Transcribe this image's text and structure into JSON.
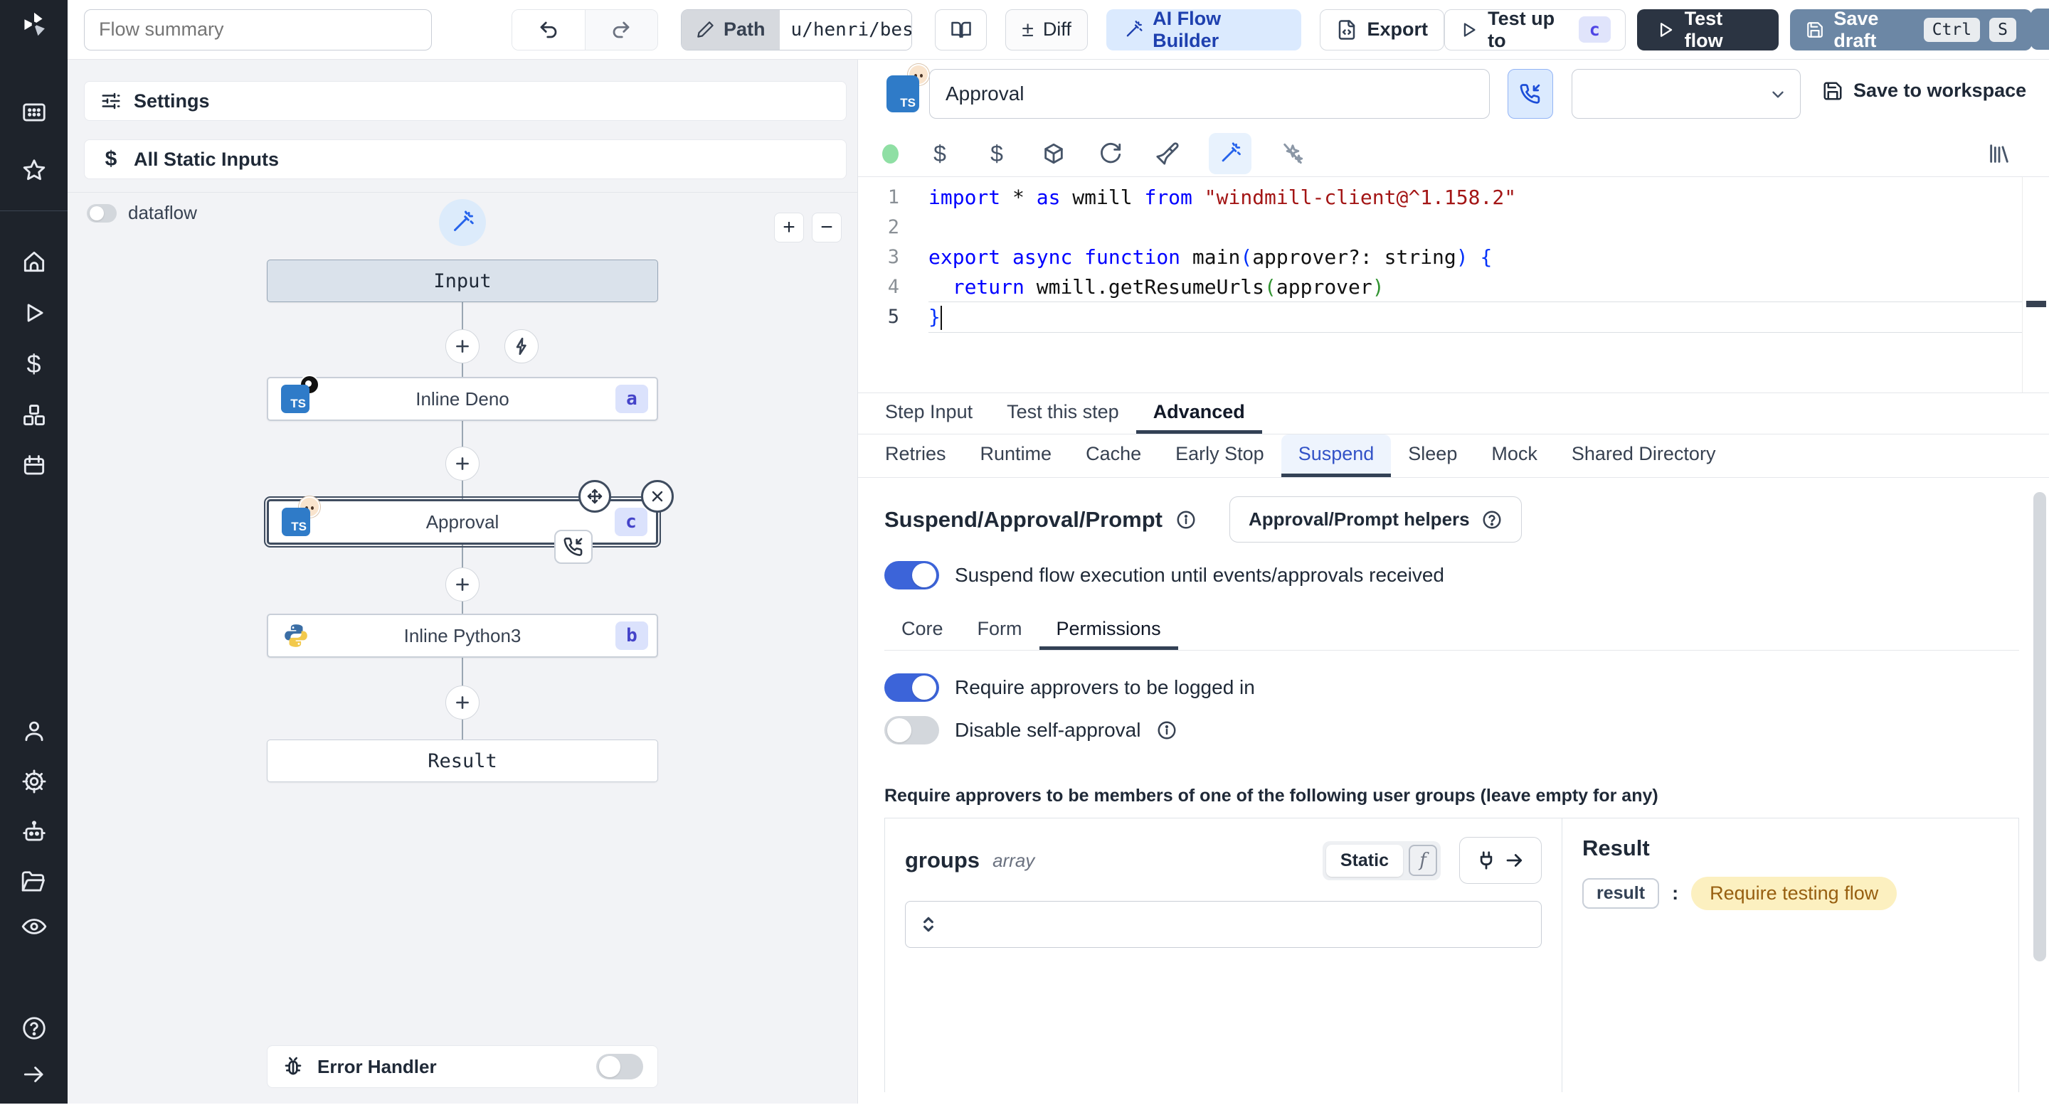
{
  "colors": {
    "rail_bg": "#1e232b",
    "accent_blue": "#3c64d9",
    "ai_button_bg": "#dbeafe",
    "test_flow_bg": "#2b3442",
    "save_draft_bg": "#6c87a5",
    "result_pill_bg": "#fcf0c0",
    "result_pill_text": "#975f10",
    "node_selected_border": "#3f4c5f",
    "suspend_tab_text": "#3353c7"
  },
  "sidebar": {
    "icons": [
      "windmill-logo",
      "apps",
      "star",
      "home",
      "runs",
      "variables",
      "resources",
      "schedules",
      "user",
      "settings",
      "workers",
      "folders",
      "audit",
      "help",
      "expand"
    ]
  },
  "topbar": {
    "flow_summary_placeholder": "Flow summary",
    "path_label": "Path",
    "path_value": "u/henri/bes",
    "diff_glyph": "±",
    "diff_label": "Diff",
    "ai_flow_builder_label": "AI Flow Builder",
    "export_label": "Export",
    "test_up_to_label": "Test up to",
    "test_up_to_badge": "c",
    "test_flow_label": "Test flow",
    "save_draft_label": "Save draft",
    "kbd_ctrl": "Ctrl",
    "kbd_s": "S"
  },
  "flow_panel": {
    "settings_label": "Settings",
    "static_inputs_label": "All Static Inputs",
    "static_inputs_icon": "$",
    "dataflow_label": "dataflow",
    "zoom_in": "+",
    "zoom_out": "−",
    "nodes": {
      "input": {
        "label": "Input"
      },
      "deno": {
        "label": "Inline Deno",
        "badge": "a",
        "lang": "TS"
      },
      "approval": {
        "label": "Approval",
        "badge": "c",
        "lang": "TS"
      },
      "python": {
        "label": "Inline Python3",
        "badge": "b"
      },
      "result": {
        "label": "Result"
      }
    },
    "error_handler_label": "Error Handler"
  },
  "step_header": {
    "lang": "TS",
    "name_value": "Approval",
    "save_to_workspace": "Save to workspace"
  },
  "editor": {
    "active_line": 4,
    "line_numbers": [
      "1",
      "2",
      "3",
      "4",
      "5"
    ],
    "lines": [
      [
        {
          "c": "kw",
          "t": "import"
        },
        {
          "c": "pl",
          "t": " * "
        },
        {
          "c": "kw",
          "t": "as"
        },
        {
          "c": "pl",
          "t": " wmill "
        },
        {
          "c": "kw",
          "t": "from"
        },
        {
          "c": "pl",
          "t": " "
        },
        {
          "c": "str",
          "t": "\"windmill-client@^1.158.2\""
        }
      ],
      [],
      [
        {
          "c": "kw",
          "t": "export"
        },
        {
          "c": "pl",
          "t": " "
        },
        {
          "c": "kw",
          "t": "async"
        },
        {
          "c": "pl",
          "t": " "
        },
        {
          "c": "kw",
          "t": "function"
        },
        {
          "c": "pl",
          "t": " main"
        },
        {
          "c": "b1",
          "t": "("
        },
        {
          "c": "pl",
          "t": "approver?: string"
        },
        {
          "c": "b1",
          "t": ")"
        },
        {
          "c": "pl",
          "t": " "
        },
        {
          "c": "b1",
          "t": "{"
        }
      ],
      [
        {
          "c": "pl",
          "t": "  "
        },
        {
          "c": "kw",
          "t": "return"
        },
        {
          "c": "pl",
          "t": " wmill.getResumeUrls"
        },
        {
          "c": "b2",
          "t": "("
        },
        {
          "c": "pl",
          "t": "approver"
        },
        {
          "c": "b2",
          "t": ")"
        }
      ],
      [
        {
          "c": "b1",
          "t": "}"
        }
      ]
    ]
  },
  "tabs": {
    "main": [
      "Step Input",
      "Test this step",
      "Advanced"
    ],
    "main_active": "Advanced",
    "advanced": [
      "Retries",
      "Runtime",
      "Cache",
      "Early Stop",
      "Suspend",
      "Sleep",
      "Mock",
      "Shared Directory"
    ],
    "advanced_active": "Suspend"
  },
  "suspend": {
    "title": "Suspend/Approval/Prompt",
    "helpers_button": "Approval/Prompt helpers",
    "suspend_toggle_label": "Suspend flow execution until events/approvals received",
    "sub_tabs": [
      "Core",
      "Form",
      "Permissions"
    ],
    "sub_active": "Permissions",
    "require_login_label": "Require approvers to be logged in",
    "disable_self_approval_label": "Disable self-approval",
    "groups_note": "Require approvers to be members of one of the following user groups (leave empty for any)",
    "groups": {
      "name": "groups",
      "type": "array",
      "static_label": "Static",
      "fx_glyph": "f"
    }
  },
  "result_panel": {
    "title": "Result",
    "key": "result",
    "colon": ":",
    "value": "Require testing flow"
  }
}
